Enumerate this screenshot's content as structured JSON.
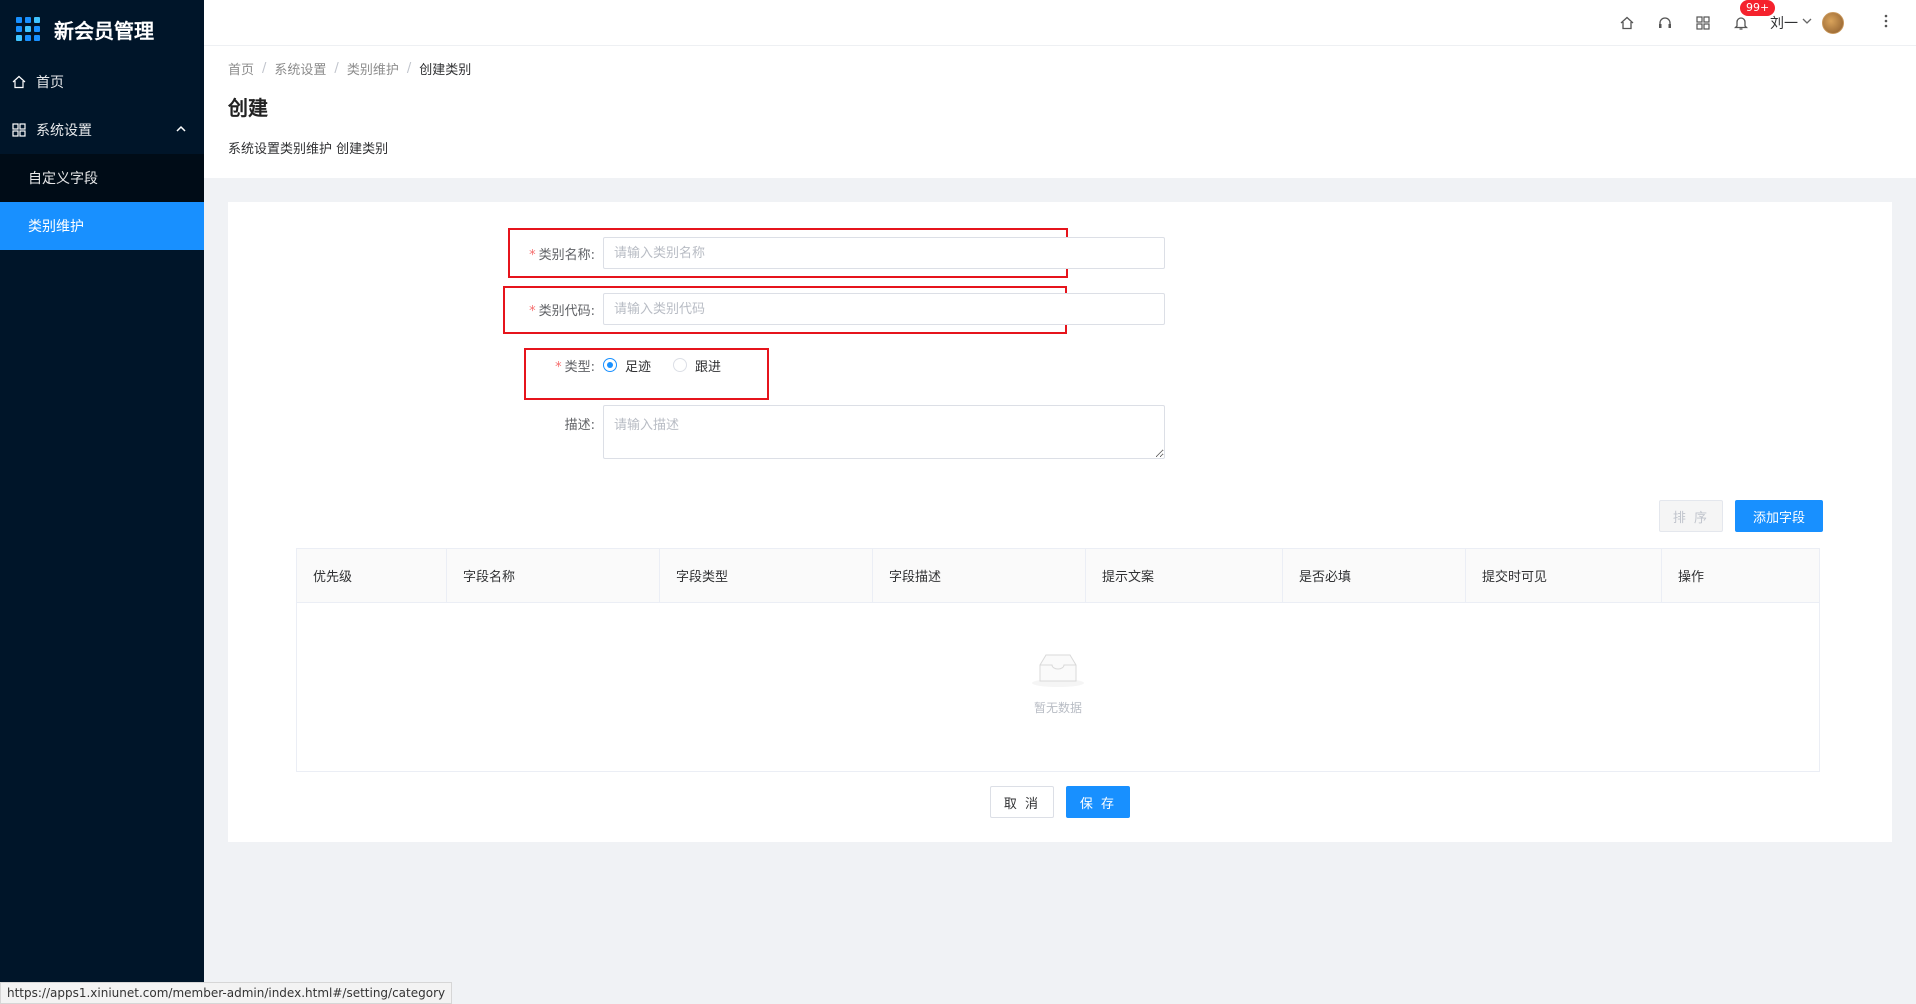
{
  "app": {
    "title": "新会员管理"
  },
  "sidebar": {
    "home": "首页",
    "group": "系统设置",
    "items": [
      {
        "label": "自定义字段",
        "active": false
      },
      {
        "label": "类别维护",
        "active": true
      }
    ]
  },
  "header": {
    "badge": "99+",
    "user": "刘一"
  },
  "breadcrumb": [
    "首页",
    "系统设置",
    "类别维护",
    "创建类别"
  ],
  "page": {
    "title": "创建",
    "desc": "系统设置类别维护 创建类别"
  },
  "form": {
    "name_label": "类别名称:",
    "name_placeholder": "请输入类别名称",
    "code_label": "类别代码:",
    "code_placeholder": "请输入类别代码",
    "type_label": "类型:",
    "type_options": [
      {
        "label": "足迹",
        "checked": true
      },
      {
        "label": "跟进",
        "checked": false
      }
    ],
    "desc_label": "描述:",
    "desc_placeholder": "请输入描述"
  },
  "table": {
    "sort_label": "排 序",
    "add_label": "添加字段",
    "columns": [
      "优先级",
      "字段名称",
      "字段类型",
      "字段描述",
      "提示文案",
      "是否必填",
      "提交时可见",
      "操作"
    ],
    "empty_text": "暂无数据"
  },
  "actions": {
    "cancel": "取 消",
    "save": "保 存"
  },
  "statusbar": "https://apps1.xiniunet.com/member-admin/index.html#/setting/category",
  "colors": {
    "primary": "#1890ff",
    "sidebar": "#001529",
    "highlight": "#e6141c"
  }
}
